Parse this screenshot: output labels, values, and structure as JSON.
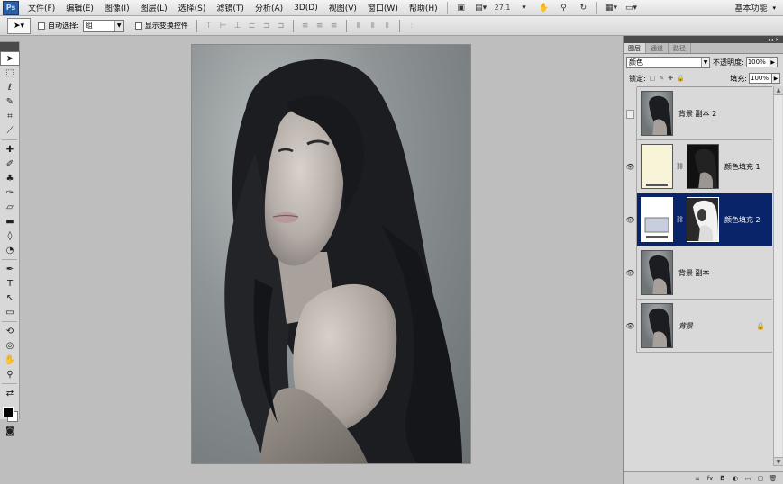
{
  "menubar": {
    "logo": "Ps",
    "items": [
      "文件(F)",
      "编辑(E)",
      "图像(I)",
      "图层(L)",
      "选择(S)",
      "滤镜(T)",
      "分析(A)",
      "3D(D)",
      "视图(V)",
      "窗口(W)",
      "帮助(H)"
    ],
    "zoom": "27.1",
    "workspace": "基本功能"
  },
  "options": {
    "auto_select_label": "自动选择:",
    "auto_select_value": "组",
    "show_transform_label": "显示变换控件"
  },
  "colors": {
    "foreground": "#000000",
    "background": "#ffffff",
    "selection": "#0a246a"
  },
  "panel": {
    "tabs": [
      "图层",
      "通道",
      "路径"
    ],
    "blend_mode": "颜色",
    "opacity_label": "不透明度:",
    "opacity_value": "100%",
    "lock_label": "锁定:",
    "fill_label": "填充:",
    "fill_value": "100%",
    "layers": [
      {
        "name": "背景 副本 2",
        "visible": false,
        "kind": "photo"
      },
      {
        "name": "颜色填充 1",
        "visible": true,
        "kind": "fill",
        "fill_color": "#f8f4d8"
      },
      {
        "name": "颜色填充 2",
        "visible": true,
        "kind": "fill",
        "fill_color": "#c8cede",
        "selected": true
      },
      {
        "name": "背景 副本",
        "visible": true,
        "kind": "photo"
      },
      {
        "name": "背景",
        "visible": true,
        "kind": "photo",
        "locked": true
      }
    ]
  }
}
